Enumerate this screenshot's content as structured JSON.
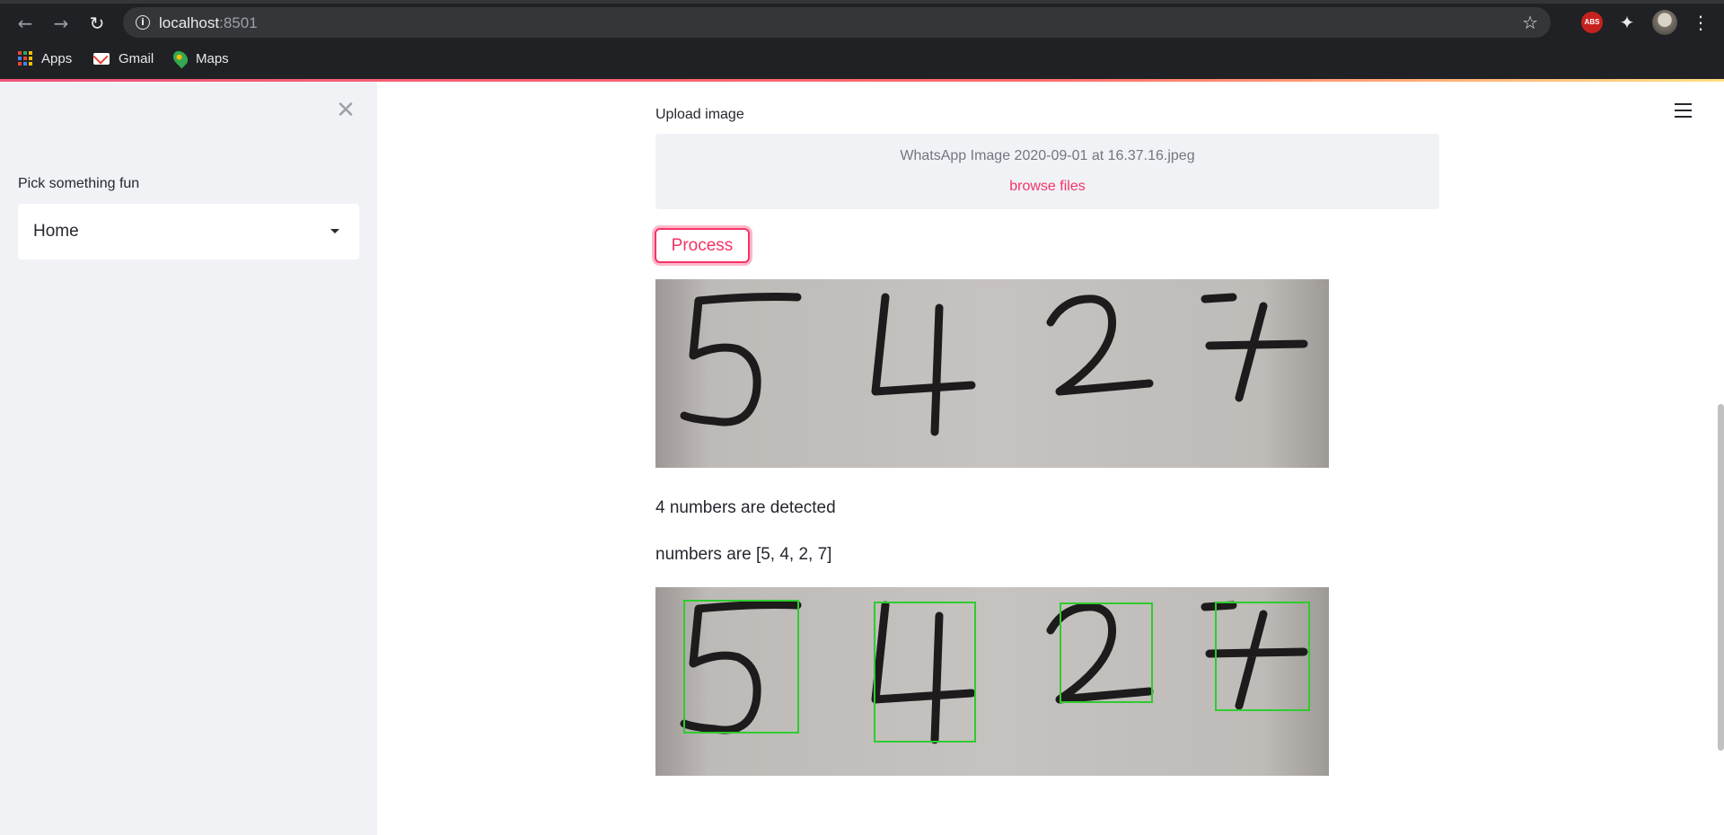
{
  "browser": {
    "url_host": "localhost",
    "url_port": ":8501",
    "bookmarks": [
      "Apps",
      "Gmail",
      "Maps"
    ],
    "extension_badge": "ABS"
  },
  "sidebar": {
    "select_label": "Pick something fun",
    "select_value": "Home"
  },
  "main": {
    "upload_label": "Upload image",
    "uploaded_file": "WhatsApp Image 2020-09-01 at 16.37.16.jpeg",
    "browse_label": "browse files",
    "process_label": "Process",
    "input_digits": [
      "5",
      "4",
      "2",
      "7"
    ],
    "detected_count_text": "4 numbers are detected",
    "numbers_text": "numbers are [5, 4, 2, 7]",
    "detected_digits": [
      "5",
      "4",
      "2",
      "7"
    ]
  },
  "colors": {
    "accent": "#f63366",
    "sidebar_bg": "#f0f2f6",
    "box_green": "#2ecc2e"
  }
}
